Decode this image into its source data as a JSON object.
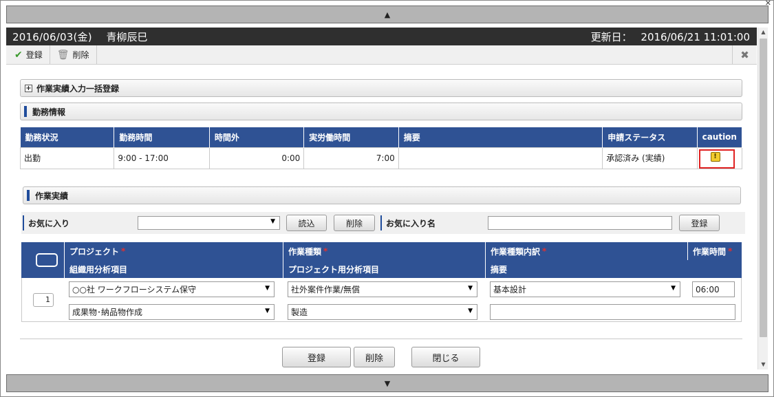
{
  "dialog": {
    "date": "2016/06/03(金)",
    "user": "青柳辰巳",
    "updated_label": "更新日：",
    "updated_value": "2016/06/21 11:01:00"
  },
  "toolbar": {
    "register_label": "登録",
    "delete_label": "削除"
  },
  "sections": {
    "bulk_register": "作業実績入力一括登録",
    "attendance_info": "勤務情報",
    "work_results": "作業実績"
  },
  "attendance": {
    "columns": [
      "勤務状況",
      "勤務時間",
      "時間外",
      "実労働時間",
      "摘要",
      "申請ステータス",
      "caution"
    ],
    "row": {
      "status": "出勤",
      "hours": "9:00 - 17:00",
      "overtime": "0:00",
      "actual": "7:00",
      "summary": "",
      "application_status": "承認済み (実績)"
    }
  },
  "favorites": {
    "label": "お気に入り",
    "selected": "",
    "load_label": "読込",
    "delete_label": "削除",
    "name_label": "お気に入り名",
    "name_value": "",
    "register_label": "登録"
  },
  "work_table": {
    "header_top": [
      "プロジェクト",
      "作業種類",
      "作業種類内訳",
      "作業時間"
    ],
    "header_bottom": [
      "組織用分析項目",
      "プロジェクト用分析項目",
      "摘要"
    ],
    "row": {
      "number": "1",
      "project": "○○社 ワークフローシステム保守",
      "work_type": "社外案件作業/無償",
      "work_detail": "基本設計",
      "work_time": "06:00",
      "org_analysis": "成果物･納品物作成",
      "project_analysis": "製造",
      "summary": ""
    }
  },
  "footer": {
    "register_label": "登録",
    "delete_label": "削除",
    "close_label": "閉じる"
  },
  "nav": {
    "up": "▲",
    "down": "▼"
  }
}
